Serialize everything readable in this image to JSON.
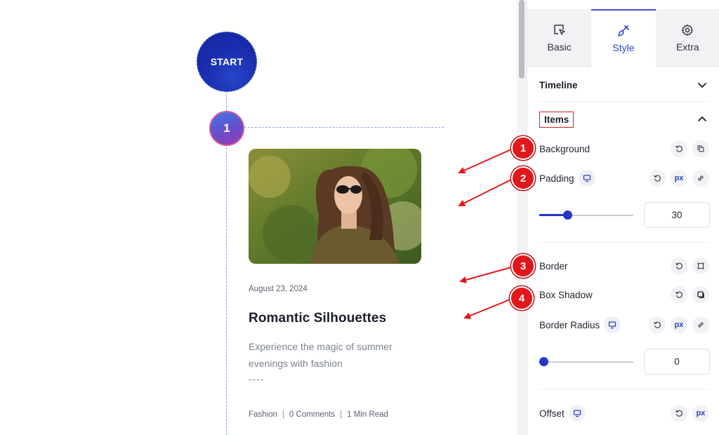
{
  "canvas": {
    "start_label": "START",
    "step_number": "1",
    "card": {
      "date": "August 23, 2024",
      "title": "Romantic Silhouettes",
      "excerpt": "Experience the magic of summer evenings with fashion",
      "separator": "----",
      "meta": {
        "category": "Fashion",
        "comments": "0 Comments",
        "read_time": "1 Min Read",
        "sep": "|"
      }
    },
    "markers": [
      "1",
      "2",
      "3",
      "4"
    ],
    "colors": {
      "accent": "#1a2fb0",
      "marker": "#e3171b",
      "timeline": "#8aa4d8"
    }
  },
  "panel": {
    "tabs": [
      {
        "label": "Basic",
        "icon": "cursor-select-icon"
      },
      {
        "label": "Style",
        "icon": "brush-icon"
      },
      {
        "label": "Extra",
        "icon": "gear-icon"
      }
    ],
    "active_tab": "Style",
    "sections": {
      "timeline": "Timeline",
      "items": "Items"
    },
    "controls": {
      "background": "Background",
      "padding": "Padding",
      "padding_value": "30",
      "padding_level": 0.3,
      "border": "Border",
      "box_shadow": "Box Shadow",
      "border_radius": "Border Radius",
      "border_radius_value": "0",
      "border_radius_level": 0,
      "offset": "Offset",
      "unit": "px"
    },
    "colors": {
      "active": "#2b3fc4",
      "slider": "#2537c9"
    }
  }
}
